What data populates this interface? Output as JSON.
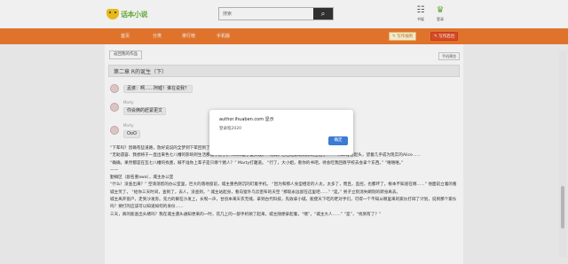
{
  "header": {
    "logo_text": "话本小说",
    "search_placeholder": "搜索",
    "search_icon": "search-icon",
    "icons": [
      {
        "name": "bookshelf-icon",
        "glyph": "☷",
        "label": "书架"
      },
      {
        "name": "user-icon",
        "glyph": "♛",
        "label": "登录"
      }
    ]
  },
  "nav": {
    "items": [
      "首页",
      "分类",
      "排行榜",
      "手机版"
    ],
    "write_guide": "写作福利",
    "write_story": "写作后台"
  },
  "page": {
    "back_button": "返回我的作品",
    "mode_button": "手机预览",
    "chapter_title": "第二章  R的诞生（下）"
  },
  "chat": [
    {
      "speaker": "",
      "text": "孟婆：啊……阿嘘！谁在说我？"
    },
    {
      "speaker": "Marty",
      "text": "你会俩的赶紧更文"
    },
    {
      "speaker": "Marty",
      "text": "OoO"
    }
  ],
  "prose": [
    "“下辈吗？因确有些道路，放好说说的全梦到下辈回到了这个时代，找找在你问心还不是没有想到的……”Marty爹爹的……",
    "“无助遗容、我想将于一直出来色七八槽的影响到生活那般不好了。” Alice健了健头发。 “可真，它已经影响到你的生活了——” Marty包起头，望着几乎成为现实的Alice……",
    "“确确，果然都是在瓦七八槽的找墨，喊不准你上辈子是只哪个猪人？” Marty打趣道。 “行了，大小姐，看你的书吧，待会吃我回教学校去会拿个东西。”  “嘻嘻嘻。”",
    "——",
    "勤摊区（副名重awa），城主办公室",
    "“什么！没查出来？” 空荡荡慌的办公室里，巨大的落地窗前，城主重色阴沉的盯着手机。 “因为和那人身型相近的人太，太多了，而且，监控，也都坏了，根本不知道在哪……” 他面前立着的看不清楚五官般的男子，汗珠滑滑滴落。",
    "城主笑了， “给你三天时间，查到了，去人，没查到，“ 城主站起身，看向窗外乌云密布的天空 “那就永远留在这里吧……” “是。” 男子立刻消失瞬刻的转身离去。",
    "城主离开窗户，走到沙发旁。充力的躺在沙发上，长呪一声，甘创本来天衣无缝，拿到古代科技，先收拿小城，能使天下吃的老对手们，可得一个不知从哪里来的家伙打碎了计划，说到那个家伙，让他很糟里，甚对十八把枪还知此涉世，绝对不是善良人能做得到，城主想到这里就有些不敢，重再然地喘的呼吸",
    "吗？要打的应该可以知道如何的身份……",
    "三天，真的能查出头绪吗？我在城主遇头通知更来的一时，花几上的一部手机顿了起来，城主随便拿起着，“喂”，“城主大人……” “是”，“找到有了？”"
  ],
  "dialog": {
    "title": "author.ihuaben.com 显示",
    "message": "登录程2020",
    "ok": "确定"
  }
}
